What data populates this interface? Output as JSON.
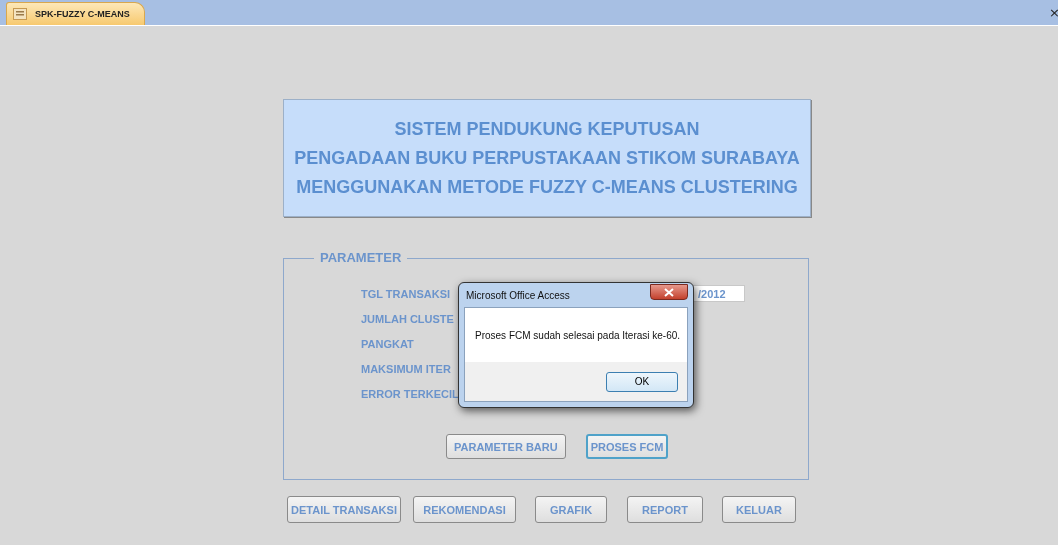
{
  "tab": {
    "title": "SPK-FUZZY C-MEANS",
    "close": "×"
  },
  "header": {
    "lines": [
      "SISTEM PENDUKUNG KEPUTUSAN",
      "PENGADAAN BUKU PERPUSTAKAAN STIKOM SURABAYA",
      "MENGGUNAKAN METODE FUZZY C-MEANS CLUSTERING"
    ]
  },
  "parameter": {
    "legend": "PARAMETER",
    "fields": [
      {
        "label": "TGL TRANSAKSI",
        "value": "/2012"
      },
      {
        "label": "JUMLAH CLUSTE"
      },
      {
        "label": "PANGKAT"
      },
      {
        "label": "MAKSIMUM ITER"
      },
      {
        "label": "ERROR TERKECIL"
      }
    ],
    "buttons": [
      {
        "label": "PARAMETER BARU",
        "focused": false
      },
      {
        "label": "PROSES FCM",
        "focused": true
      }
    ]
  },
  "nav_buttons": [
    "DETAIL TRANSAKSI",
    "REKOMENDASI",
    "GRAFIK",
    "REPORT",
    "KELUAR"
  ],
  "dialog": {
    "title": "Microsoft Office Access",
    "message": "Proses FCM sudah selesai pada Iterasi ke-60.",
    "ok": "OK"
  }
}
